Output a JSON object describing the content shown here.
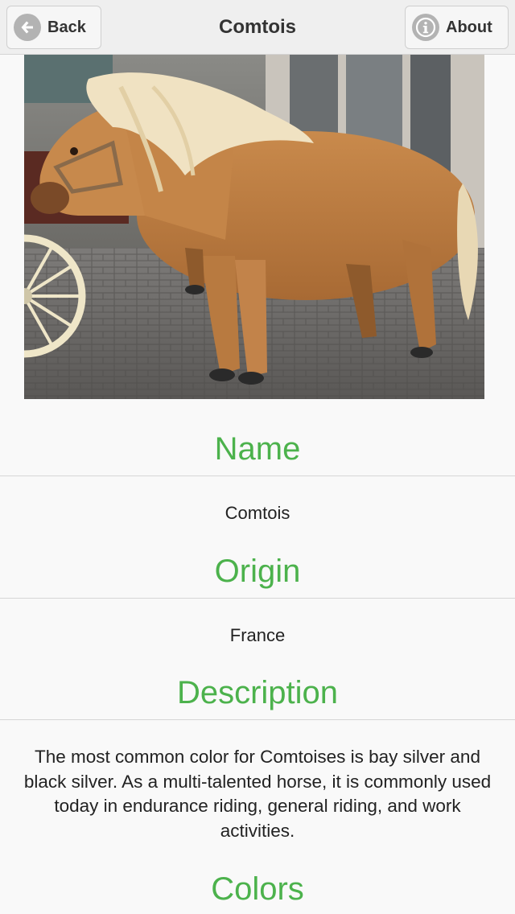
{
  "header": {
    "back_label": "Back",
    "title": "Comtois",
    "about_label": "About"
  },
  "photo": {
    "subject": "chestnut Comtois horse with flaxen mane beside a carriage on cobblestones"
  },
  "sections": {
    "name": {
      "title": "Name",
      "value": "Comtois"
    },
    "origin": {
      "title": "Origin",
      "value": "France"
    },
    "description": {
      "title": "Description",
      "lines": [
        "The most common color for Comtoises is bay silver and",
        "black silver. As a multi-talented horse, it is commonly used",
        "today in endurance riding, general riding, and work",
        "activities."
      ]
    },
    "colors": {
      "title": "Colors"
    }
  },
  "colors": {
    "accent": "#4cb24c",
    "navbar": "#efefef",
    "icon": "#b3b3b3"
  },
  "icons": {
    "back": "arrow-left-circle-icon",
    "about": "info-circle-icon"
  }
}
